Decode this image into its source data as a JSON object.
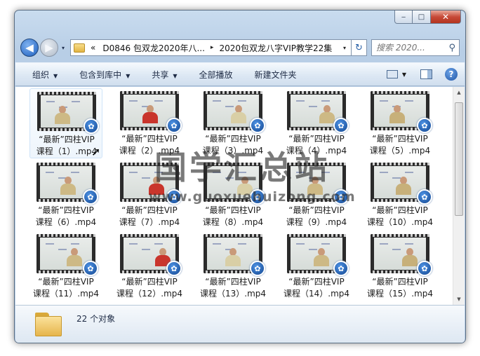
{
  "window": {
    "caption": {
      "minimize": "‒",
      "maximize": "□",
      "close": "✕"
    }
  },
  "address_bar": {
    "overflow": "«",
    "crumbs": [
      "D0846 包双龙2020年八...",
      "2020包双龙八字VIP教学22集"
    ],
    "separator": "▸",
    "dropdown": "▾",
    "refresh": "↻"
  },
  "search": {
    "placeholder": "搜索 2020...",
    "icon": "search-icon"
  },
  "nav": {
    "back": "◀",
    "forward": "▶",
    "recent": "▾"
  },
  "toolbar": {
    "organize": "组织",
    "include_in_library": "包含到库中",
    "share": "共享",
    "play_all": "全部播放",
    "new_folder": "新建文件夹",
    "dropdown_arrow": "▼",
    "help": "?"
  },
  "files": [
    {
      "line1": "“最新”四柱VIP",
      "line2": "课程（1）.mp4",
      "selected": true
    },
    {
      "line1": "“最新”四柱VIP",
      "line2": "课程（2）.mp4"
    },
    {
      "line1": "“最新”四柱VIP",
      "line2": "课程（3）.mp4"
    },
    {
      "line1": "“最新”四柱VIP",
      "line2": "课程（4）.mp4"
    },
    {
      "line1": "“最新”四柱VIP",
      "line2": "课程（5）.mp4"
    },
    {
      "line1": "“最新”四柱VIP",
      "line2": "课程（6）.mp4"
    },
    {
      "line1": "“最新”四柱VIP",
      "line2": "课程（7）.mp4"
    },
    {
      "line1": "“最新”四柱VIP",
      "line2": "课程（8）.mp4"
    },
    {
      "line1": "“最新”四柱VIP",
      "line2": "课程（9）.mp4"
    },
    {
      "line1": "“最新”四柱VIP",
      "line2": "课程（10）.mp4"
    },
    {
      "line1": "“最新”四柱VIP",
      "line2": "课程（11）.mp4"
    },
    {
      "line1": "“最新”四柱VIP",
      "line2": "课程（12）.mp4"
    },
    {
      "line1": "“最新”四柱VIP",
      "line2": "课程（13）.mp4"
    },
    {
      "line1": "“最新”四柱VIP",
      "line2": "课程（14）.mp4"
    },
    {
      "line1": "“最新”四柱VIP",
      "line2": "课程（15）.mp4"
    }
  ],
  "details": {
    "count": "22 个对象"
  },
  "watermark": {
    "cn": "国学汇总站",
    "en": "www.guoxuehuizong.com"
  },
  "colors": {
    "accent": "#1d5fbf",
    "selection": "#cfe4f8",
    "frame": "#b8cee6"
  }
}
